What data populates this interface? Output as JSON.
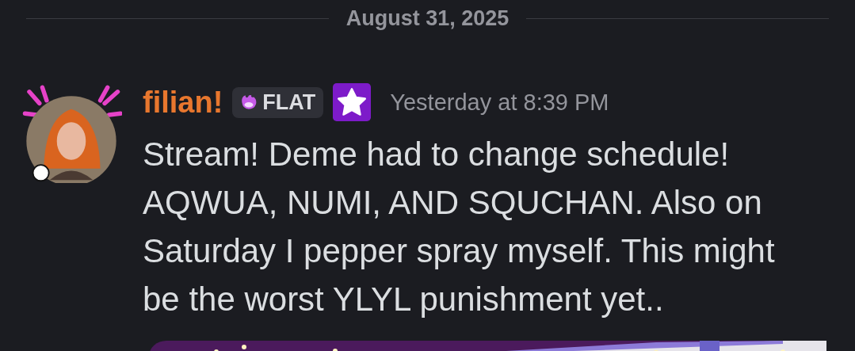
{
  "date_divider": "August 31, 2025",
  "message": {
    "author": "filian!",
    "tag": {
      "label": "FLAT"
    },
    "timestamp": "Yesterday at 8:39 PM",
    "text": "Stream! Deme had to change schedule! AQWUA, NUMI, AND SQUCHAN. Also on Saturday I pepper spray myself. This might be the worst YLYL punishment yet.."
  }
}
